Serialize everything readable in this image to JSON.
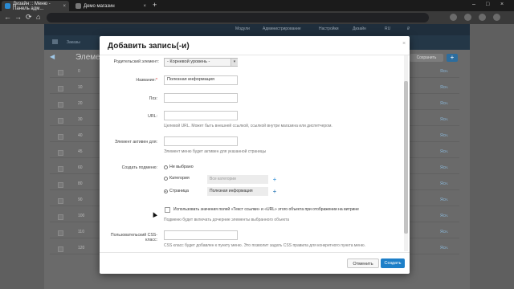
{
  "browser": {
    "tabs": [
      {
        "title": "Дизайн :: Меню - Панель адм...",
        "close": "×"
      },
      {
        "title": "Демо магазин",
        "close": "×"
      }
    ],
    "new_tab": "+",
    "window_controls": [
      "–",
      "□",
      "×"
    ],
    "nav": {
      "back": "←",
      "forward": "→",
      "reload": "⟳",
      "home": "⌂"
    }
  },
  "admin": {
    "menu": [
      "Модули",
      "Администрирование",
      "Настройки",
      "Дизайн",
      "RU",
      "₽"
    ],
    "breadcrumb": "Заказы",
    "page_title": "Элеме",
    "save_label": "Сохранить",
    "plus_label": "+",
    "back_label": "◀",
    "rows": [
      {
        "n": "0",
        "link": "Ясн."
      },
      {
        "n": "10",
        "link": "Ясн."
      },
      {
        "n": "20",
        "link": "Ясн."
      },
      {
        "n": "30",
        "link": "Ясн."
      },
      {
        "n": "40",
        "link": "Ясн."
      },
      {
        "n": "45",
        "link": "Ясн."
      },
      {
        "n": "60",
        "link": "Ясн."
      },
      {
        "n": "80",
        "link": "Ясн."
      },
      {
        "n": "90",
        "link": "Ясн."
      },
      {
        "n": "100",
        "link": "Ясн."
      },
      {
        "n": "110",
        "link": "Ясн."
      },
      {
        "n": "120",
        "link": "Ясн."
      }
    ]
  },
  "modal": {
    "title": "Добавить запись(-и)",
    "close": "×",
    "parent_label": "Родительский элемент:",
    "parent_value": "- Корневой уровень -",
    "name_label": "Название:",
    "name_value": "Полезная информация",
    "pos_label": "Поз:",
    "pos_value": "",
    "url_label": "URL:",
    "url_value": "",
    "url_hint": "Целевой URL. Может быть внешней ссылкой, ссылкой внутри магазина или диспетчером.",
    "active_label": "Элемент активен для:",
    "active_value": "",
    "active_hint": "Элемент меню будет активен для указанной страницы",
    "create_sub_label": "Создать подменю:",
    "opt_none": "Не выбрано",
    "opt_category": "Категория",
    "opt_category_value": "Все категории",
    "opt_page": "Страница",
    "opt_page_value": "Полезная информация",
    "selected_option": "page",
    "use_values_label": "Использовать значения полей «Текст ссылки» и «URL» этого объекта при отображении на витрине",
    "use_values_hint": "Подменю будет включать дочерние элементы выбранного объекта",
    "css_label_1": "Пользовательский CSS-",
    "css_label_2": "класс:",
    "css_value": "",
    "css_hint": "CSS класс будет добавлен к пункту меню. Это позволит задать CSS правила для конкретного пункта меню.",
    "cancel_label": "Отменить",
    "create_label": "Создать",
    "plus": "+"
  }
}
